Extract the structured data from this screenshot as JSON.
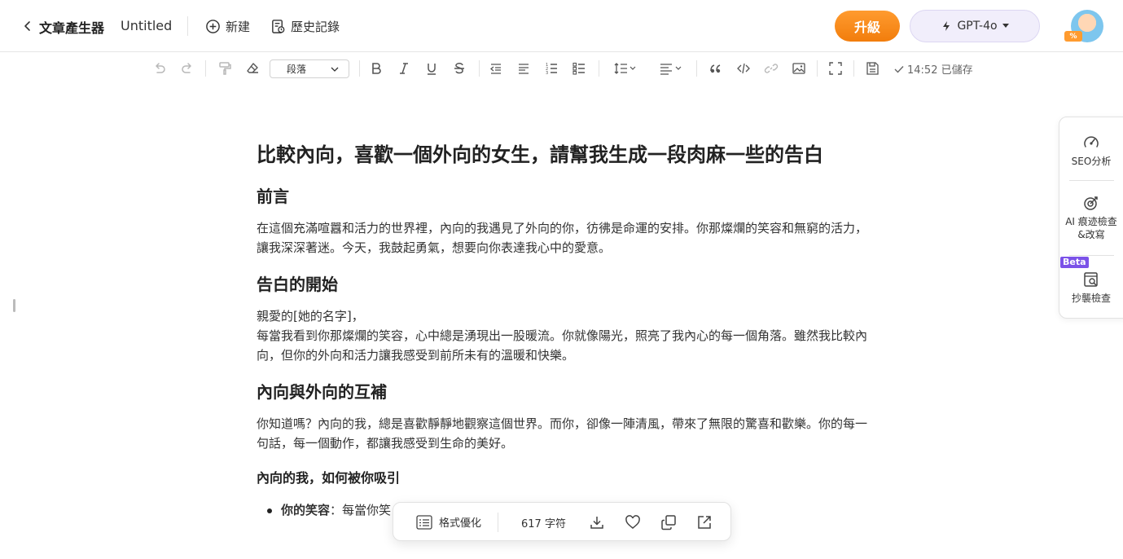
{
  "header": {
    "app_title": "文章產生器",
    "doc_title": "Untitled",
    "new_label": "新建",
    "history_label": "歷史記錄",
    "upgrade_label": "升級",
    "model_label": "GPT-4o",
    "avatar_badge": "%"
  },
  "toolbar": {
    "paragraph_select": "段落",
    "saved_status": "14:52 已儲存"
  },
  "document": {
    "title": "比較內向，喜歡一個外向的女生，請幫我生成一段肉麻一些的告白",
    "sections": [
      {
        "heading": "前言",
        "lines": [
          "在這個充滿喧囂和活力的世界裡，內向的我遇見了外向的你，彷彿是命運的安排。你那燦爛的笑容和無窮的活力，",
          "讓我深深著迷。今天，我鼓起勇氣，想要向你表達我心中的愛意。"
        ]
      },
      {
        "heading": "告白的開始",
        "lines": [
          "親愛的[她的名字]，",
          "每當我看到你那燦爛的笑容，心中總是湧現出一股暖流。你就像陽光，照亮了我內心的每一個角落。雖然我比較內",
          "向，但你的外向和活力讓我感受到前所未有的溫暖和快樂。"
        ]
      },
      {
        "heading": "內向與外向的互補",
        "lines": [
          "你知道嗎？內向的我，總是喜歡靜靜地觀察這個世界。而你，卻像一陣清風，帶來了無限的驚喜和歡樂。你的每一",
          "句話，每一個動作，都讓我感受到生命的美好。"
        ]
      }
    ],
    "subheading": "內向的我，如何被你吸引",
    "bullet": {
      "bold": "你的笑容",
      "text": "：每當你笑"
    }
  },
  "sidepanel": {
    "seo_label": "SEO分析",
    "ai_label_1": "AI 痕迹檢查",
    "ai_label_2": "&改寫",
    "beta_label": "Beta",
    "plagiarism_label": "抄襲檢查"
  },
  "bottombar": {
    "format_label": "格式優化",
    "char_count": "617 字符"
  }
}
